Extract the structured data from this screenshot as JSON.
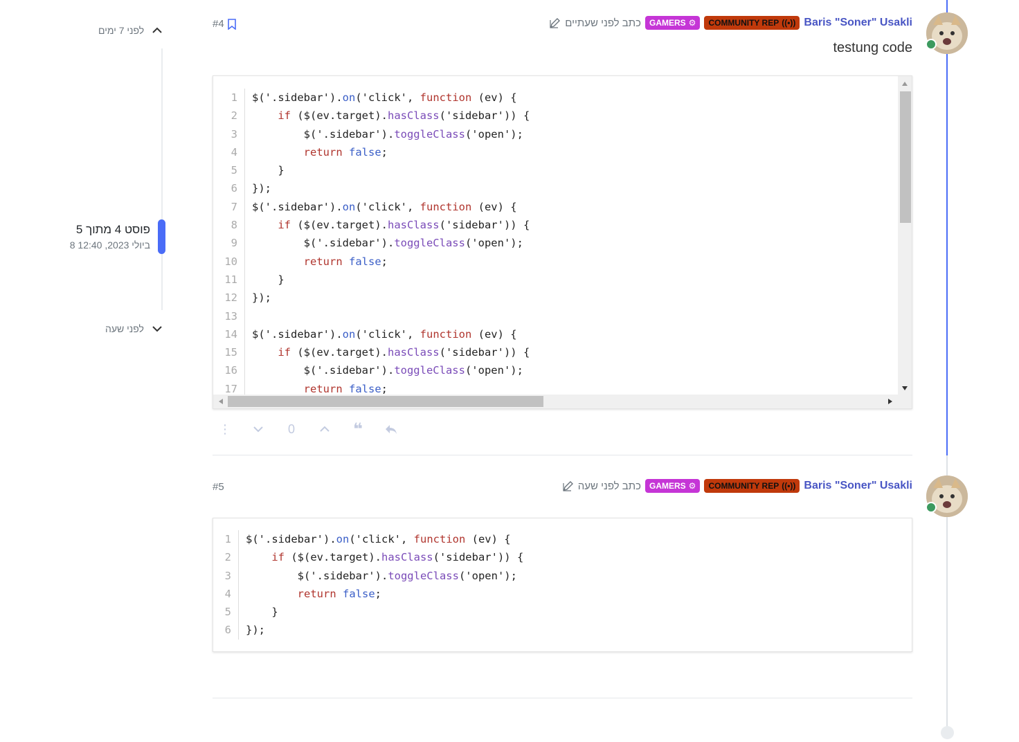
{
  "navigator": {
    "top_label": "לפני 7 ימים",
    "current_count": "פוסט 4 מתוך 5",
    "current_date": "8 ביולי 2023, 12:40",
    "bottom_label": "לפני שעה"
  },
  "colors": {
    "accent": "#4a6cf7",
    "author": "#4855c4",
    "badge_rep": "#c0390b",
    "badge_gamers": "#c535d6",
    "online": "#3c9a5f"
  },
  "posts": [
    {
      "index": "#4",
      "author": "Baris \"Soner\" Usakli",
      "badges": [
        "COMMUNITY REP",
        "GAMERS"
      ],
      "time": "כתב לפני שעתיים",
      "text": "testung code",
      "upvotes": "0",
      "line_numbers": [
        "1",
        "2",
        "3",
        "4",
        "5",
        "6",
        "7",
        "8",
        "9",
        "10",
        "11",
        "12",
        "13",
        "14",
        "15",
        "16",
        "17"
      ]
    },
    {
      "index": "#5",
      "author": "Baris \"Soner\" Usakli",
      "badges": [
        "COMMUNITY REP",
        "GAMERS"
      ],
      "time": "כתב לפני שעה",
      "line_numbers": [
        "1",
        "2",
        "3",
        "4",
        "5",
        "6"
      ]
    }
  ],
  "code": {
    "line_a": "$('.sidebar').",
    "on": "on",
    "line_a2": "('click', ",
    "function_kw": "function",
    "line_a3": " (ev) {",
    "if_kw": "if",
    "line_b": " ($(ev.target).",
    "hasClass": "hasClass",
    "line_b2": "('sidebar')) {",
    "line_c": "$('.sidebar').",
    "toggleClass": "toggleClass",
    "line_c2": "('open');",
    "return_kw": "return",
    "false_lit": "false",
    "semi": ";",
    "close_brace": "}",
    "close_call": "});"
  }
}
